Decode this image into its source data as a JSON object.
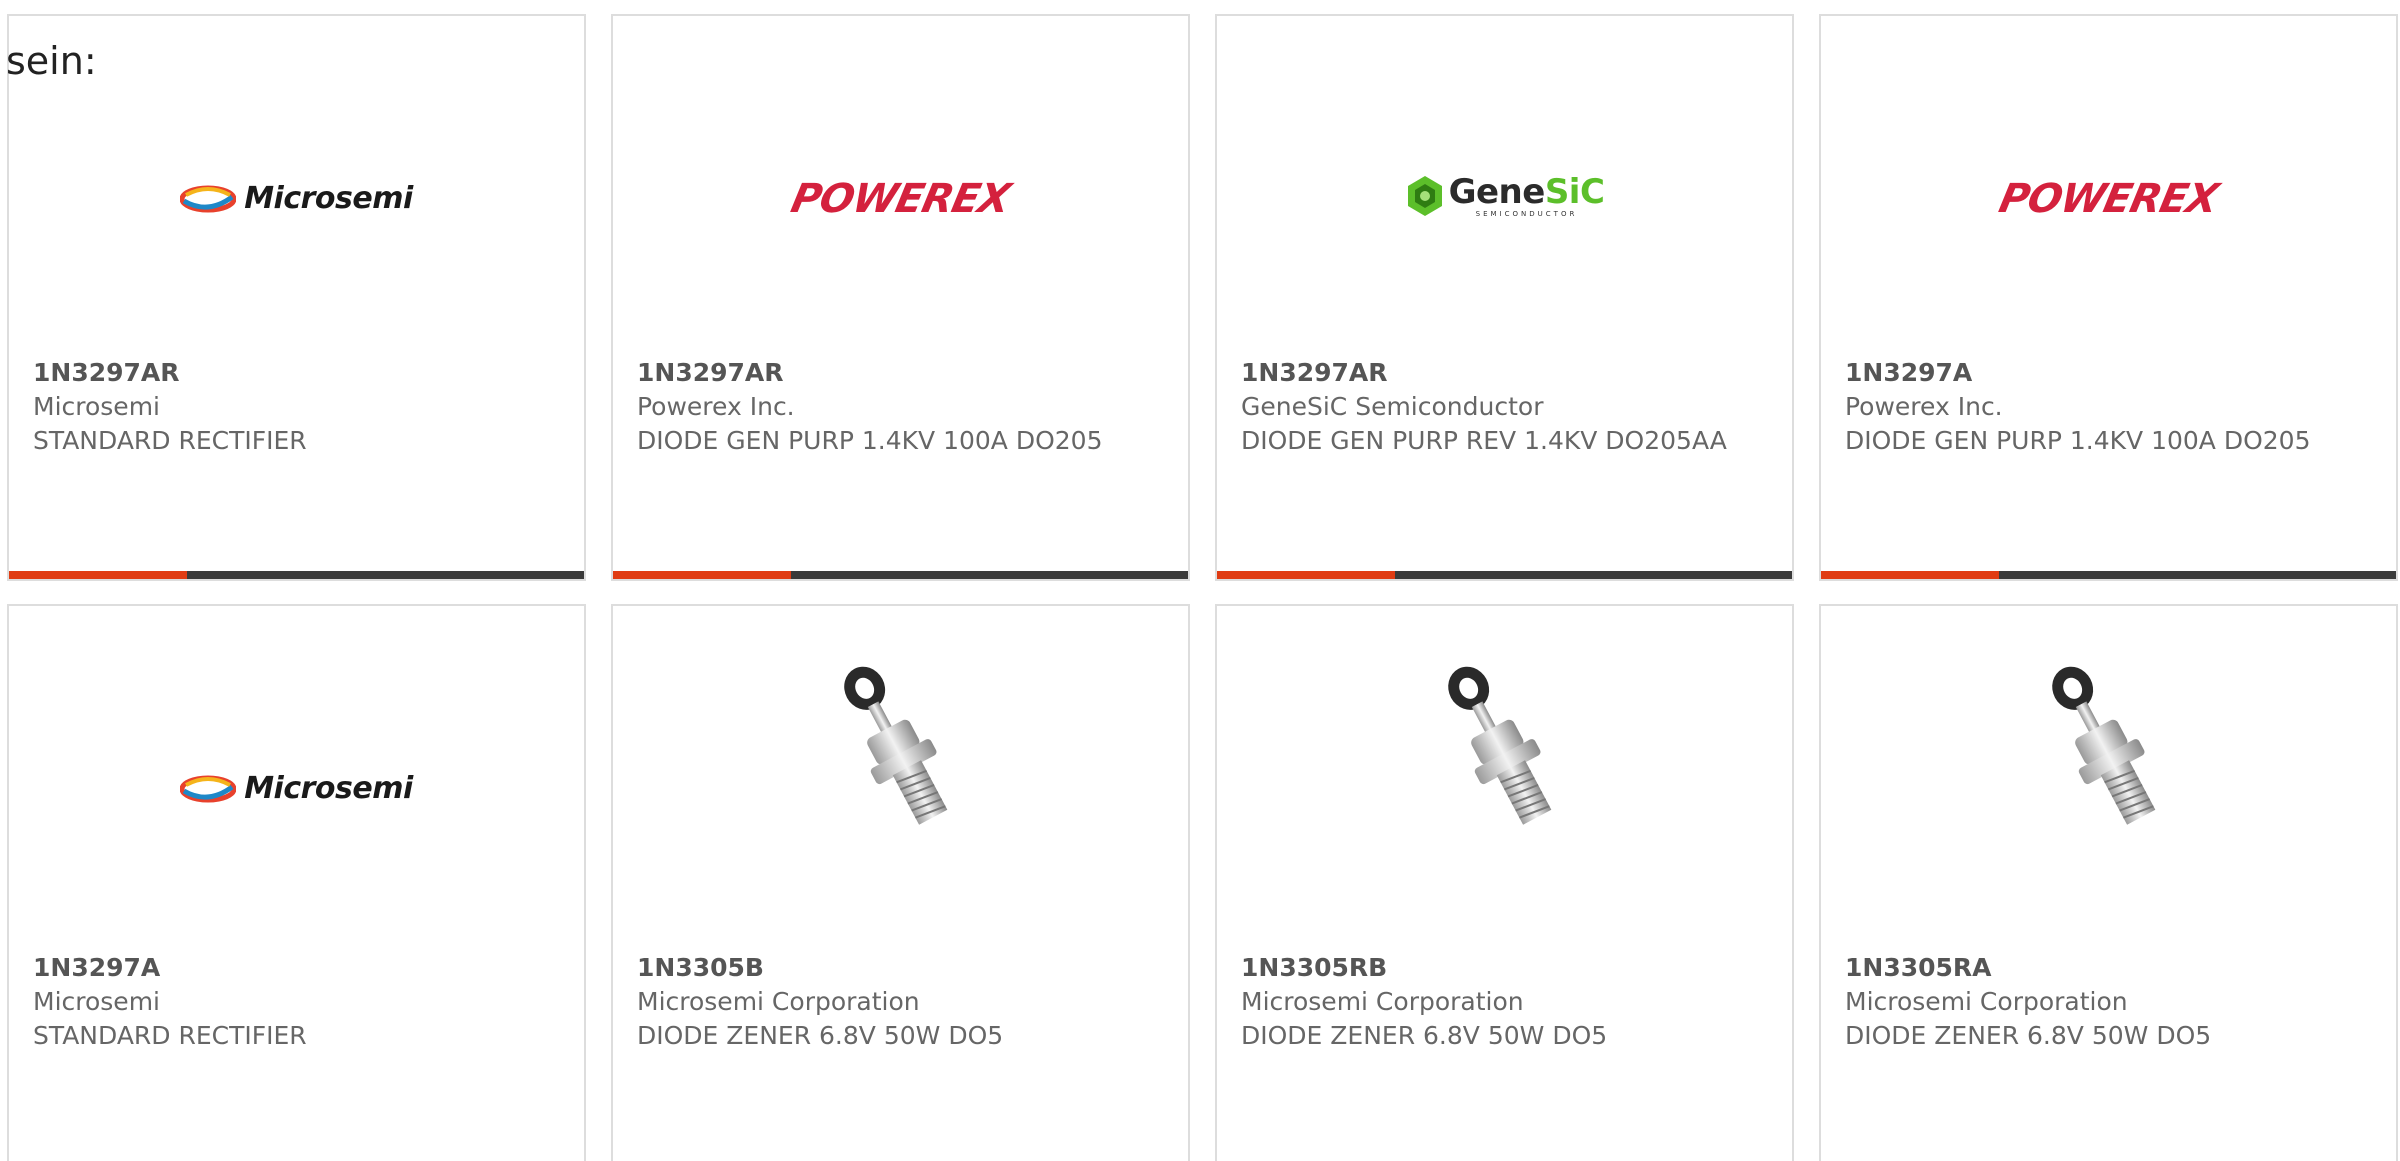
{
  "intro_text": "sein:",
  "colors": {
    "accent": "#e03c13",
    "bar": "#3a3a3a",
    "card_border": "#dddddd",
    "text": "#666666"
  },
  "cards": [
    {
      "image": "microsemi-logo",
      "logo_text": "Microsemi",
      "part_number": "1N3297AR",
      "manufacturer": "Microsemi",
      "description": "STANDARD RECTIFIER",
      "progress": 0.31
    },
    {
      "image": "powerex-logo",
      "logo_text": "POWEREX",
      "part_number": "1N3297AR",
      "manufacturer": "Powerex Inc.",
      "description": "DIODE GEN PURP 1.4KV 100A DO205",
      "progress": 0.31
    },
    {
      "image": "genesic-logo",
      "logo_text": "GeneSiC",
      "logo_subtext": "SEMICONDUCTOR",
      "part_number": "1N3297AR",
      "manufacturer": "GeneSiC Semiconductor",
      "description": "DIODE GEN PURP REV 1.4KV DO205AA",
      "progress": 0.31
    },
    {
      "image": "powerex-logo",
      "logo_text": "POWEREX",
      "part_number": "1N3297A",
      "manufacturer": "Powerex Inc.",
      "description": "DIODE GEN PURP 1.4KV 100A DO205",
      "progress": 0.31
    },
    {
      "image": "microsemi-logo",
      "logo_text": "Microsemi",
      "part_number": "1N3297A",
      "manufacturer": "Microsemi",
      "description": "STANDARD RECTIFIER"
    },
    {
      "image": "stud-diode-photo",
      "part_number": "1N3305B",
      "manufacturer": "Microsemi Corporation",
      "description": "DIODE ZENER 6.8V 50W DO5"
    },
    {
      "image": "stud-diode-photo",
      "part_number": "1N3305RB",
      "manufacturer": "Microsemi Corporation",
      "description": "DIODE ZENER 6.8V 50W DO5"
    },
    {
      "image": "stud-diode-photo",
      "part_number": "1N3305RA",
      "manufacturer": "Microsemi Corporation",
      "description": "DIODE ZENER 6.8V 50W DO5"
    }
  ]
}
